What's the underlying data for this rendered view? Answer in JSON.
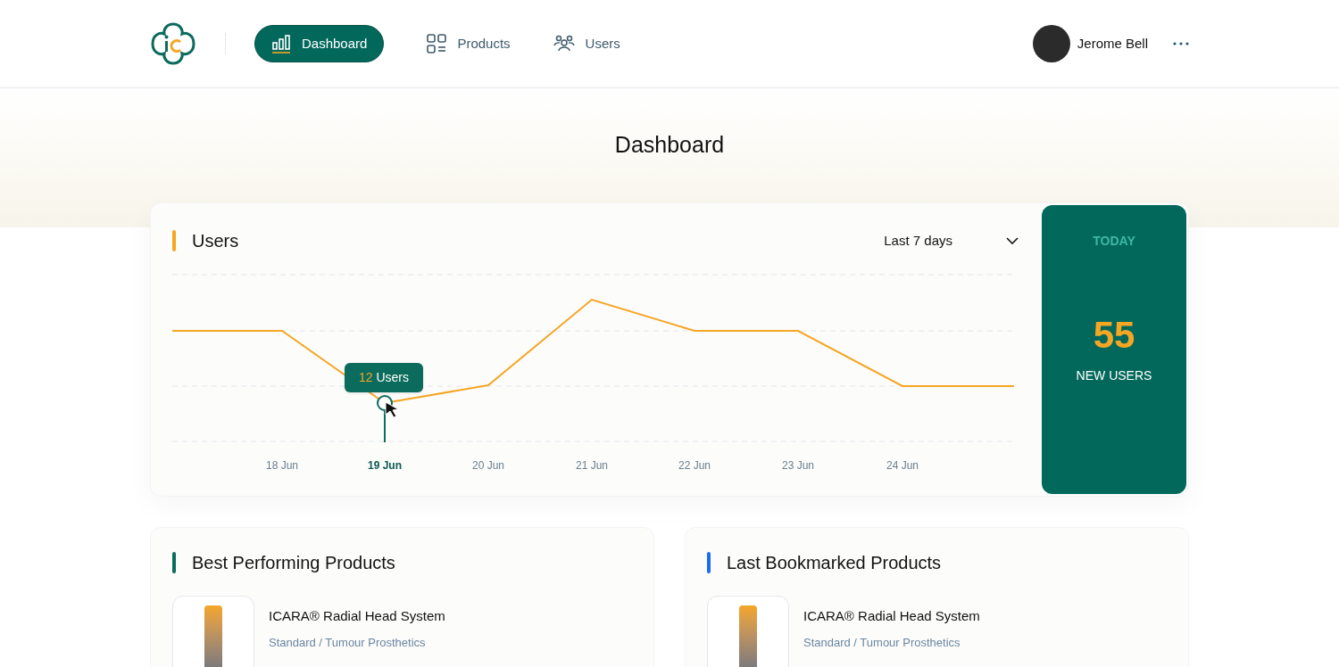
{
  "nav": {
    "items": [
      {
        "label": "Dashboard",
        "kind": "chart",
        "selected": true
      },
      {
        "label": "Products",
        "kind": "grid",
        "selected": false
      },
      {
        "label": "Users",
        "kind": "people",
        "selected": false
      }
    ]
  },
  "user": {
    "name": "Jerome Bell"
  },
  "page_title": "Dashboard",
  "users_card": {
    "title": "Users",
    "range": "Last 7 days",
    "x_labels": [
      {
        "label": "18 Jun",
        "selected": false
      },
      {
        "label": "19 Jun",
        "selected": true
      },
      {
        "label": "20 Jun",
        "selected": false
      },
      {
        "label": "21 Jun",
        "selected": false
      },
      {
        "label": "22 Jun",
        "selected": false
      },
      {
        "label": "23 Jun",
        "selected": false
      },
      {
        "label": "24 Jun",
        "selected": false
      }
    ],
    "tooltip": {
      "value": "12",
      "unit": "Users"
    }
  },
  "today": {
    "label": "TODAY",
    "value": "55",
    "caption": "NEW USERS"
  },
  "panels": [
    {
      "title": "Best Performing Products",
      "color": "#0b6b5c",
      "products": [
        {
          "name": "ICARA® Radial Head System",
          "category": "Standard / Tumour Prosthetics"
        }
      ]
    },
    {
      "title": "Last Bookmarked Products",
      "color": "#1a6cf0",
      "products": [
        {
          "name": "ICARA® Radial Head System",
          "category": "Standard / Tumour Prosthetics"
        }
      ]
    }
  ]
}
